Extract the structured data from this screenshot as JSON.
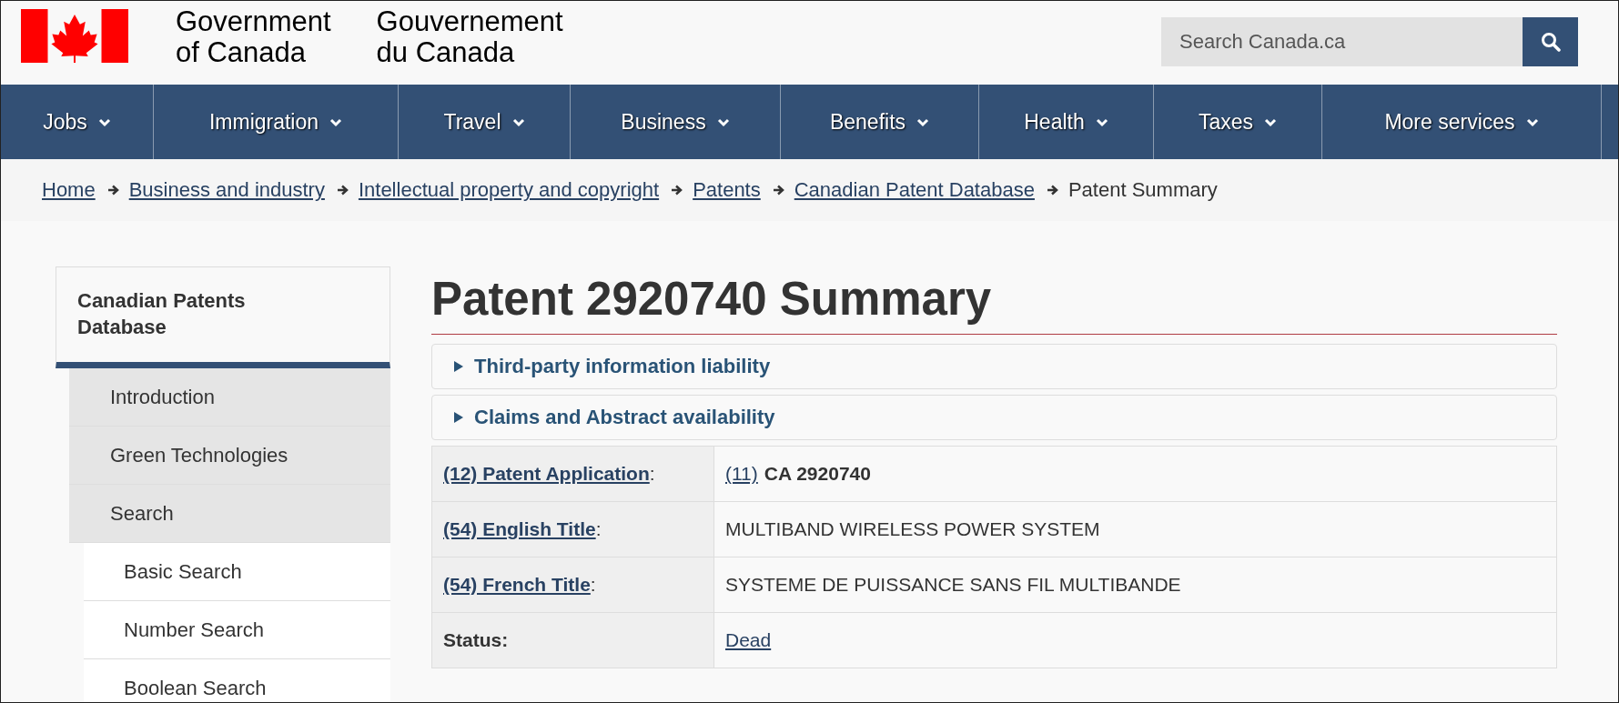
{
  "header": {
    "title_en": [
      "Government",
      "of Canada"
    ],
    "title_fr": [
      "Gouvernement",
      "du Canada"
    ],
    "search": {
      "placeholder": "Search Canada.ca"
    }
  },
  "nav": [
    {
      "label": "Jobs"
    },
    {
      "label": "Immigration"
    },
    {
      "label": "Travel"
    },
    {
      "label": "Business"
    },
    {
      "label": "Benefits"
    },
    {
      "label": "Health"
    },
    {
      "label": "Taxes"
    },
    {
      "label": "More services"
    }
  ],
  "breadcrumb": [
    {
      "label": "Home",
      "link": true
    },
    {
      "label": "Business and industry",
      "link": true
    },
    {
      "label": "Intellectual property and copyright",
      "link": true
    },
    {
      "label": "Patents",
      "link": true
    },
    {
      "label": "Canadian Patent Database",
      "link": true
    },
    {
      "label": "Patent Summary",
      "link": false
    }
  ],
  "sidebar": {
    "title": "Canadian Patents Database",
    "items": [
      {
        "label": "Introduction"
      },
      {
        "label": "Green Technologies"
      },
      {
        "label": "Search",
        "children": [
          {
            "label": "Basic Search"
          },
          {
            "label": "Number Search"
          },
          {
            "label": "Boolean Search"
          }
        ]
      }
    ]
  },
  "main": {
    "title": "Patent 2920740 Summary",
    "sections": [
      {
        "label": "Third-party information liability",
        "expanded": false
      },
      {
        "label": "Claims and Abstract availability",
        "expanded": false
      }
    ],
    "table": {
      "rows": [
        {
          "label": "(12) Patent Application",
          "label_link": true,
          "label_suffix": ":",
          "value_ref": "(11)",
          "value": "CA 2920740",
          "value_bold": true,
          "value_link": false
        },
        {
          "label": "(54) English Title",
          "label_link": true,
          "label_suffix": ":",
          "value": "MULTIBAND WIRELESS POWER SYSTEM",
          "value_bold": false,
          "value_link": false
        },
        {
          "label": "(54) French Title",
          "label_link": true,
          "label_suffix": ":",
          "value": "SYSTEME DE PUISSANCE SANS FIL MULTIBANDE",
          "value_bold": false,
          "value_link": false
        },
        {
          "label": "Status",
          "label_link": false,
          "label_suffix": ":",
          "value": "Dead",
          "value_bold": false,
          "value_link": true
        }
      ]
    }
  }
}
